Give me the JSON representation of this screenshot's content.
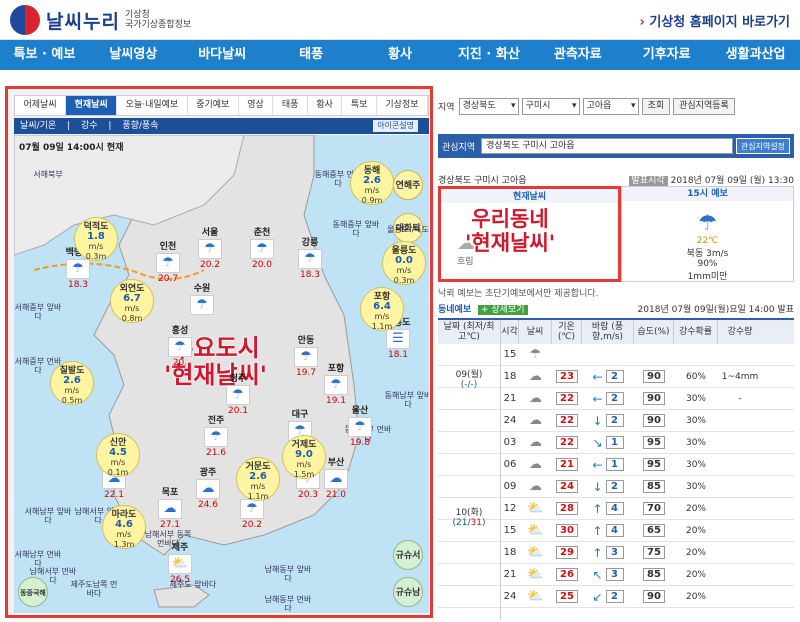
{
  "header": {
    "logo_main": "날씨누리",
    "logo_sub1": "기상청",
    "logo_sub2": "국가기상종합정보",
    "home_link": "기상청 홈페이지 바로가기"
  },
  "nav": [
    "특보 · 예보",
    "날씨영상",
    "바다날씨",
    "태풍",
    "황사",
    "지진 · 화산",
    "관측자료",
    "기후자료",
    "생활과산업"
  ],
  "left": {
    "tabs": [
      "어제날씨",
      "현재날씨",
      "오늘·내일예보",
      "중기예보",
      "영상",
      "태풍",
      "황사",
      "특보",
      "기상정보"
    ],
    "active_tab": 1,
    "subtabs": [
      "날씨/기온",
      "강수",
      "풍향/풍속"
    ],
    "icon_btn": "아이콘설명",
    "timestamp": "07월 09일 14:00시 현재",
    "side_buttons": [
      "연해주",
      "대화퇴",
      "규슈서해",
      "규슈남해",
      "동중국해"
    ],
    "overlay_text": [
      "주요도시",
      "'현재날씨'"
    ],
    "regions": [
      "서해북부",
      "동해중부 먼바다",
      "서해중부 앞바다",
      "서해중부 먼바다",
      "동해중부 앞바다",
      "동해남부 앞바다",
      "동해남부 먼바다",
      "서해남부 앞바다",
      "남해서부 앞바다",
      "남해서부 먼바다",
      "남해동부 앞바다",
      "남해동부 먼바다",
      "남해서부 동쪽먼바다",
      "서해남부 먼바다",
      "제주도남쪽 먼바다",
      "제주도 앞바다",
      "울릉도 /독도"
    ],
    "cities": [
      {
        "name": "서울",
        "temp": "20.2",
        "icon": "☂"
      },
      {
        "name": "춘천",
        "temp": "20.0",
        "icon": "☂"
      },
      {
        "name": "강릉",
        "temp": "18.3",
        "icon": "☂"
      },
      {
        "name": "인천",
        "temp": "20.7",
        "icon": "☂"
      },
      {
        "name": "백령도",
        "temp": "18.3",
        "icon": "☂"
      },
      {
        "name": "수원",
        "temp": "",
        "icon": "☂"
      },
      {
        "name": "홍성",
        "temp": "20.",
        "icon": "☂"
      },
      {
        "name": "안동",
        "temp": "19.7",
        "icon": "☂"
      },
      {
        "name": "청주",
        "temp": "20.1",
        "icon": "☂"
      },
      {
        "name": "포항",
        "temp": "19.1",
        "icon": "☂"
      },
      {
        "name": "전주",
        "temp": "21.6",
        "icon": "☂"
      },
      {
        "name": "대구",
        "temp": "20.6",
        "icon": "☂"
      },
      {
        "name": "울산",
        "temp": "19.8",
        "icon": "☂"
      },
      {
        "name": "흑산도",
        "temp": "22.1",
        "icon": "☁"
      },
      {
        "name": "광주",
        "temp": "24.6",
        "icon": "☁"
      },
      {
        "name": "창원",
        "temp": "20.3",
        "icon": "☂"
      },
      {
        "name": "부산",
        "temp": "21.0",
        "icon": "☁"
      },
      {
        "name": "목포",
        "temp": "27.1",
        "icon": "☁"
      },
      {
        "name": "여수",
        "temp": "20.2",
        "icon": "☂"
      },
      {
        "name": "제주",
        "temp": "26.5",
        "icon": "⛅"
      },
      {
        "name": "울릉도",
        "temp": "18.1",
        "icon": "☰"
      }
    ],
    "winds": [
      {
        "name": "덕적도",
        "speed": "1.8",
        "unit": "m/s",
        "wave": "0.3m"
      },
      {
        "name": "외연도",
        "speed": "6.7",
        "unit": "m/s",
        "wave": "0.8m"
      },
      {
        "name": "칠발도",
        "speed": "2.6",
        "unit": "m/s",
        "wave": "0.5m"
      },
      {
        "name": "신안",
        "speed": "4.5",
        "unit": "m/s",
        "wave": "0.1m"
      },
      {
        "name": "마라도",
        "speed": "4.6",
        "unit": "m/s",
        "wave": "1.3m"
      },
      {
        "name": "동해",
        "speed": "2.6",
        "unit": "m/s",
        "wave": "0.9m"
      },
      {
        "name": "울릉도",
        "speed": "0.0",
        "unit": "m/s",
        "wave": "0.3m"
      },
      {
        "name": "포항",
        "speed": "6.4",
        "unit": "m/s",
        "wave": "1.1m"
      },
      {
        "name": "거제도",
        "speed": "9.0",
        "unit": "m/s",
        "wave": "1.5m"
      },
      {
        "name": "거문도",
        "speed": "2.6",
        "unit": "m/s",
        "wave": "1.1m"
      }
    ]
  },
  "right": {
    "region_label": "지역",
    "selects": [
      "경상북도",
      "구미시",
      "고아읍"
    ],
    "search_btn": "조회",
    "fav_register_btn": "관심지역등록",
    "fav_label": "관심지역",
    "fav_value": "경상북도 구미시 고아읍",
    "fav_setting_btn": "관심지역설정",
    "location": "경상북도 구미시 고아읍",
    "issue_badge": "발표시각",
    "issue_time": "2018년 07월 09일 (월) 13:30",
    "current_head": "현재날씨",
    "current_overlay": [
      "우리동네",
      "'현재날씨'"
    ],
    "current_state": "흐림",
    "forecast_head": "15시 예보",
    "forecast_temp": "22℃",
    "forecast_wind": "북동 3m/s",
    "forecast_humidity": "90%",
    "forecast_rain": "1mm미만",
    "note": "낙뢰 예보는 초단기예보에서만 제공합니다.",
    "section_title": "동네예보",
    "detail_btn": "+ 상세보기",
    "section_time": "2018년 07월 09일(월)요일 14:00 발표",
    "columns": [
      "날짜 (최저/최고℃)",
      "시각",
      "날씨",
      "기온(℃)",
      "바람 (풍향,m/s)",
      "습도(%)",
      "강수확률",
      "강수량"
    ],
    "days": [
      {
        "label": "09(월)",
        "minmax": "(-/-)",
        "rows": 3
      },
      {
        "label": "10(화)",
        "minmax_min": "21",
        "minmax_max": "31",
        "rows": 9
      }
    ],
    "rows": [
      {
        "hour": "15",
        "icon": "☂",
        "temp": "",
        "dir": "",
        "speed": "",
        "hum": "",
        "prob": "",
        "amt": ""
      },
      {
        "hour": "18",
        "icon": "☁",
        "temp": "23",
        "dir": "←",
        "speed": "2",
        "hum": "90",
        "prob": "60%",
        "amt": "1~4mm"
      },
      {
        "hour": "21",
        "icon": "☁",
        "temp": "22",
        "dir": "←",
        "speed": "2",
        "hum": "90",
        "prob": "30%",
        "amt": "-"
      },
      {
        "hour": "24",
        "icon": "☁",
        "temp": "22",
        "dir": "↓",
        "speed": "2",
        "hum": "90",
        "prob": "30%",
        "amt": ""
      },
      {
        "hour": "03",
        "icon": "☁",
        "temp": "22",
        "dir": "↘",
        "speed": "1",
        "hum": "95",
        "prob": "30%",
        "amt": ""
      },
      {
        "hour": "06",
        "icon": "☁",
        "temp": "21",
        "dir": "←",
        "speed": "1",
        "hum": "95",
        "prob": "30%",
        "amt": ""
      },
      {
        "hour": "09",
        "icon": "☁",
        "temp": "24",
        "dir": "↓",
        "speed": "2",
        "hum": "85",
        "prob": "30%",
        "amt": ""
      },
      {
        "hour": "12",
        "icon": "⛅",
        "temp": "28",
        "dir": "↑",
        "speed": "4",
        "hum": "70",
        "prob": "20%",
        "amt": ""
      },
      {
        "hour": "15",
        "icon": "⛅",
        "temp": "30",
        "dir": "↑",
        "speed": "4",
        "hum": "65",
        "prob": "20%",
        "amt": ""
      },
      {
        "hour": "18",
        "icon": "⛅",
        "temp": "29",
        "dir": "↑",
        "speed": "3",
        "hum": "75",
        "prob": "20%",
        "amt": ""
      },
      {
        "hour": "21",
        "icon": "⛅",
        "temp": "26",
        "dir": "↖",
        "speed": "3",
        "hum": "85",
        "prob": "20%",
        "amt": ""
      },
      {
        "hour": "24",
        "icon": "⛅",
        "temp": "25",
        "dir": "↙",
        "speed": "2",
        "hum": "90",
        "prob": "20%",
        "amt": ""
      }
    ]
  }
}
